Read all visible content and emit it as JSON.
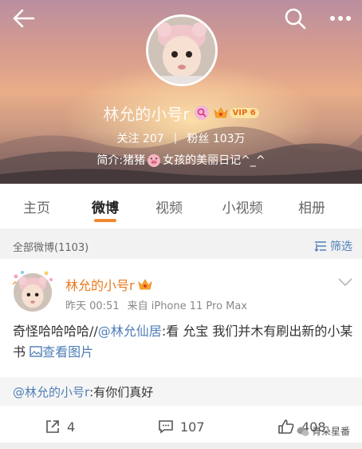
{
  "header": {
    "profile_name": "林允的小号r",
    "vip_label": "VIP 6",
    "stats": {
      "follow_label": "关注",
      "follow_count": "207",
      "separator": "|",
      "fans_label": "粉丝",
      "fans_count": "103万"
    },
    "intro_prefix": "简介:猪猪",
    "intro_suffix": "女孩的美丽日记^_^"
  },
  "tabs": [
    {
      "label": "主页",
      "active": false
    },
    {
      "label": "微博",
      "active": true
    },
    {
      "label": "视频",
      "active": false
    },
    {
      "label": "小视频",
      "active": false
    },
    {
      "label": "相册",
      "active": false
    }
  ],
  "filter": {
    "count_label": "全部微博(1103)",
    "filter_label": "筛选"
  },
  "post": {
    "author": "林允的小号r",
    "time": "昨天 00:51",
    "source": "来自 iPhone 11 Pro Max",
    "text_prefix": "奇怪哈哈哈哈//",
    "mention": "@林允仙居",
    "text_suffix": ":看 允宝 我们并木有刷出新的小某书",
    "view_pic_label": "查看图片",
    "repost_mention": "@林允的小号r",
    "repost_text": ":有你们真好",
    "repost_count": "4",
    "comment_count": "107",
    "like_count": "408"
  },
  "watermark": "青朵星番",
  "colors": {
    "accent_orange": "#eb7a1f",
    "link_blue": "#4f7fb7",
    "tab_underline": "#f28a2f"
  }
}
